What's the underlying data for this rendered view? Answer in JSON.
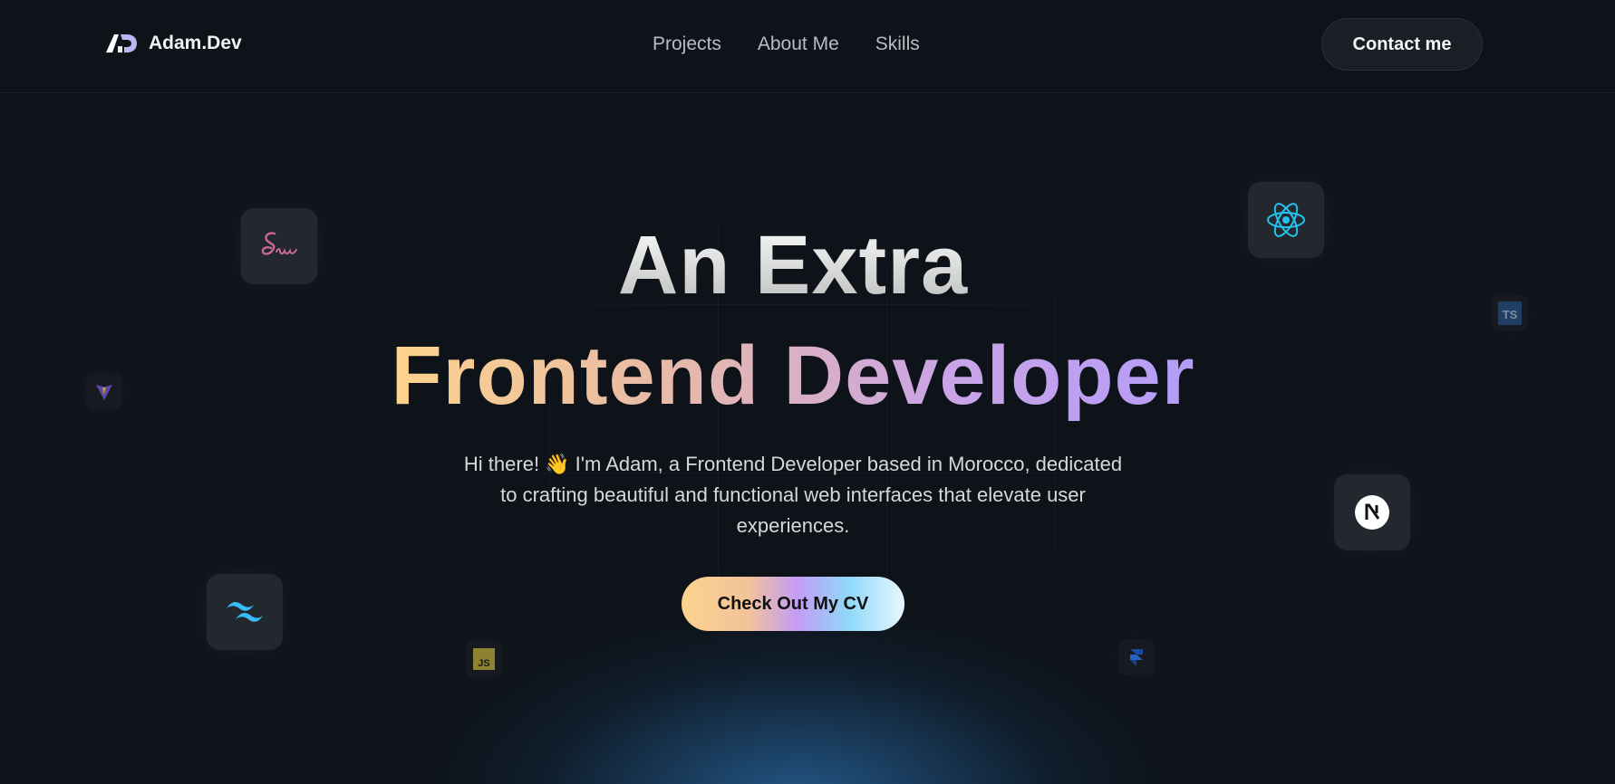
{
  "nav": {
    "brand_name": "Adam.Dev",
    "links": [
      {
        "label": "Projects"
      },
      {
        "label": "About Me"
      },
      {
        "label": "Skills"
      }
    ],
    "contact_label": "Contact me"
  },
  "hero": {
    "title_line1": "An Extra",
    "title_line2": "Frontend Developer",
    "description": "Hi there! 👋 I'm Adam, a Frontend Developer based in Morocco, dedicated to crafting beautiful and functional web interfaces that elevate user experiences.",
    "cv_button_label": "Check Out My CV"
  },
  "tech_icons": [
    {
      "name": "sass-icon",
      "color": "#cd6799"
    },
    {
      "name": "react-icon",
      "color": "#22c4ee"
    },
    {
      "name": "nextjs-icon",
      "color": "#ffffff"
    },
    {
      "name": "tailwind-icon",
      "color": "#38bdf8"
    },
    {
      "name": "vite-icon",
      "color": "#a259ff"
    },
    {
      "name": "typescript-icon",
      "color": "#3178c6"
    },
    {
      "name": "javascript-icon",
      "color": "#f0db4f"
    },
    {
      "name": "framer-icon",
      "color": "#0055ff"
    }
  ],
  "colors": {
    "background": "#0e1319",
    "accent_gradient_start": "#fdd38c",
    "accent_gradient_end": "#b49cf7"
  }
}
